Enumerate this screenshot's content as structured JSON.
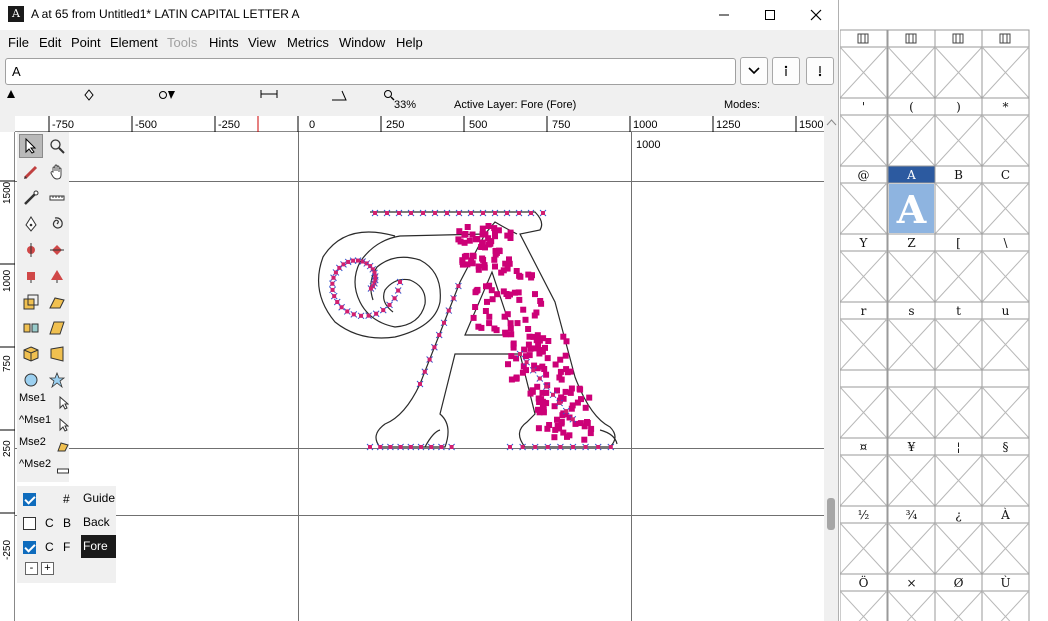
{
  "window": {
    "title": "A at 65 from Untitled1* LATIN CAPITAL LETTER A",
    "app_icon_letter": "A"
  },
  "menu": {
    "items": [
      "File",
      "Edit",
      "Point",
      "Element",
      "Tools",
      "Hints",
      "View",
      "Metrics",
      "Window",
      "Help"
    ],
    "disabled": [
      "Tools"
    ]
  },
  "glyph_field": {
    "value": "A"
  },
  "infobar": {
    "zoom": "33%",
    "active_layer": "Active Layer: Fore (Fore)",
    "modes": "Modes:"
  },
  "ruler": {
    "ticks": [
      "-750",
      "-500",
      "-250",
      "0",
      "250",
      "500",
      "750",
      "1000",
      "1250",
      "1500"
    ],
    "vertical_ticks": [
      "1500",
      "1250",
      "1000",
      "750",
      "500",
      "250",
      "0",
      "-250"
    ]
  },
  "canvas": {
    "advance_label": "1000",
    "accent_color": "#cc0077",
    "point_color": "#d12070",
    "cross_color": "#3355cc"
  },
  "toolbox": {
    "mouse_labels": [
      "Mse1",
      "^Mse1",
      "Mse2",
      "^Mse2"
    ]
  },
  "layers": {
    "rows": [
      {
        "checked": true,
        "code1": "",
        "code2": "#",
        "name": "Guide",
        "active": false
      },
      {
        "checked": false,
        "code1": "C",
        "code2": "B",
        "name": "Back",
        "active": false
      },
      {
        "checked": true,
        "code1": "C",
        "code2": "F",
        "name": "Fore",
        "active": true
      }
    ],
    "remove_label": "-",
    "add_label": "+"
  },
  "fontview": {
    "highlight_color": "#2c5aa0",
    "cell_fill_color": "#8eb4e0",
    "rows": [
      [
        "",
        "",
        "",
        ""
      ],
      [
        "'",
        "(",
        ")",
        "*"
      ],
      [
        "@",
        "A",
        "B",
        "C"
      ],
      [
        "Y",
        "Z",
        "[",
        "\\"
      ],
      [
        "r",
        "s",
        "t",
        "u"
      ],
      [
        "",
        "",
        "",
        ""
      ],
      [
        "¤",
        "¥",
        "¦",
        "§"
      ],
      [
        "½",
        "¾",
        "¿",
        "À"
      ],
      [
        "Ö",
        "×",
        "Ø",
        "Ù"
      ]
    ],
    "selected": "A"
  }
}
